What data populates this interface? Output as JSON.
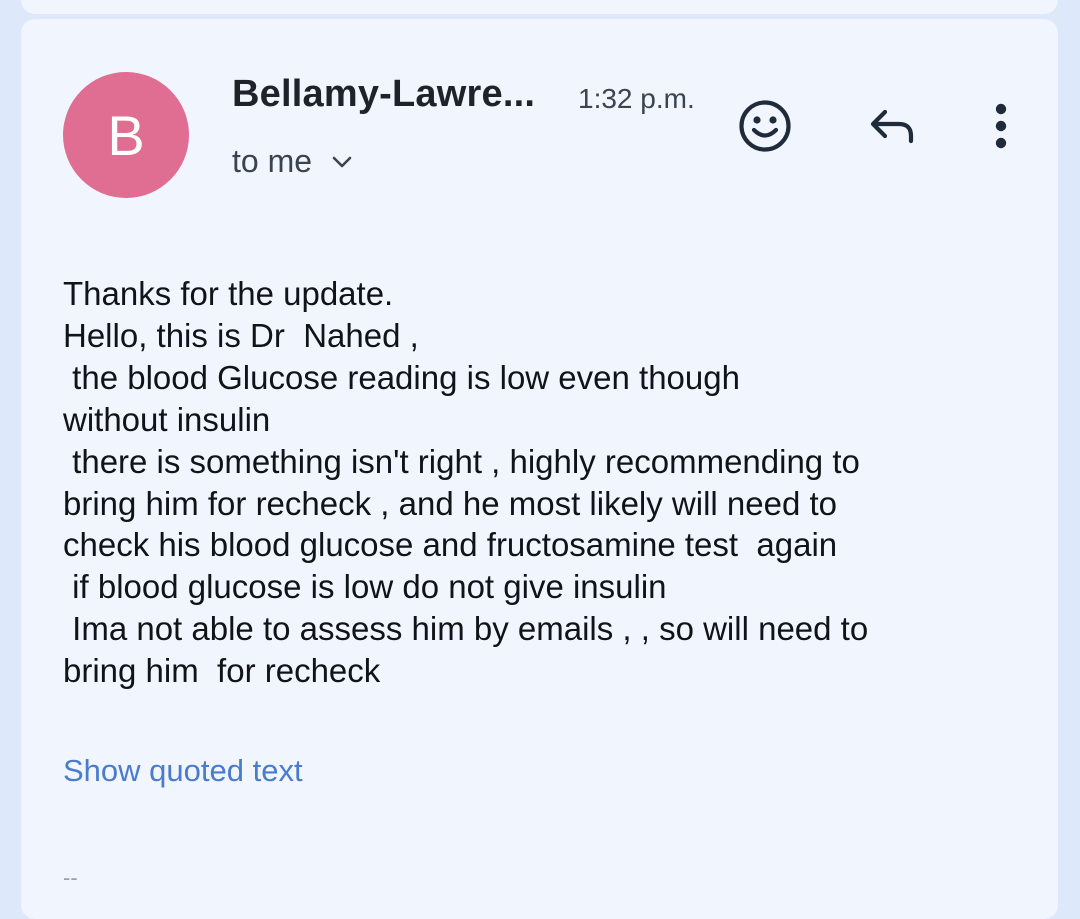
{
  "message": {
    "sender_initial": "B",
    "sender_name": "Bellamy-Lawre...",
    "time": "1:32 p.m.",
    "recipient_label": "to me",
    "avatar_color": "#e06d92",
    "body": "Thanks for the update.\nHello, this is Dr  Nahed ,\n the blood Glucose reading is low even though\nwithout insulin\n there is something isn't right , highly recommending to\nbring him for recheck , and he most likely will need to\ncheck his blood glucose and fructosamine test  again\n if blood glucose is low do not give insulin\n Ima not able to assess him by emails , , so will need to\nbring him  for recheck",
    "show_quoted_label": "Show quoted text",
    "signature_separator": "--"
  },
  "icons": {
    "recipient_expand": "chevron-down-icon",
    "react": "emoji-smile-icon",
    "reply": "reply-icon",
    "more": "more-vert-icon"
  },
  "colors": {
    "background": "#dde8fb",
    "card": "#f1f5fd",
    "link": "#4a7bcd"
  }
}
